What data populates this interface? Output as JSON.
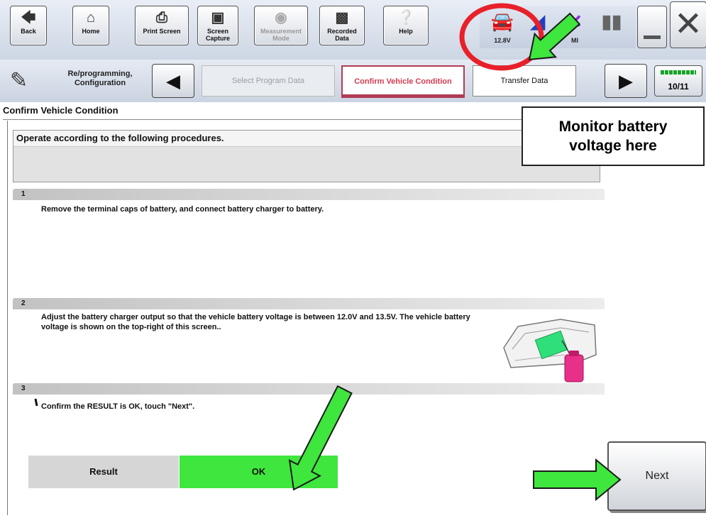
{
  "toolbar": {
    "buttons": [
      {
        "label": "Back"
      },
      {
        "label": "Home"
      },
      {
        "label": "Print Screen"
      },
      {
        "label": "Screen Capture"
      },
      {
        "label": "Measurement Mode"
      },
      {
        "label": "Recorded Data"
      },
      {
        "label": "Help"
      }
    ],
    "status": {
      "battery_voltage": "12.8V",
      "vi_label": "VI",
      "mi_label": "MI"
    }
  },
  "nav": {
    "mode_label": "Re/programming, Configuration",
    "steps": {
      "previous": "Select Program Data",
      "current": "Confirm Vehicle Condition",
      "next": "Transfer Data"
    },
    "progress": "10/11"
  },
  "section_title": "Confirm Vehicle Condition",
  "instructions_heading": "Operate according to the following procedures.",
  "steps": [
    {
      "number": "1",
      "text": "Remove the terminal caps of battery, and connect battery charger to battery."
    },
    {
      "number": "2",
      "text": "Adjust the battery charger output so that the vehicle battery voltage is between 12.0V and 13.5V. The vehicle battery voltage is shown on the top-right of this screen.."
    },
    {
      "number": "3",
      "text": "Confirm the RESULT is OK, touch \"Next\"."
    }
  ],
  "result": {
    "label": "Result",
    "value": "OK"
  },
  "next_button": "Next",
  "callout": {
    "line1": "Monitor battery",
    "line2": "voltage here"
  },
  "colors": {
    "result_ok": "#3ee63e",
    "arrow": "#3ee63e",
    "highlight_circle": "#e8202a",
    "current_step": "#d23c52"
  }
}
